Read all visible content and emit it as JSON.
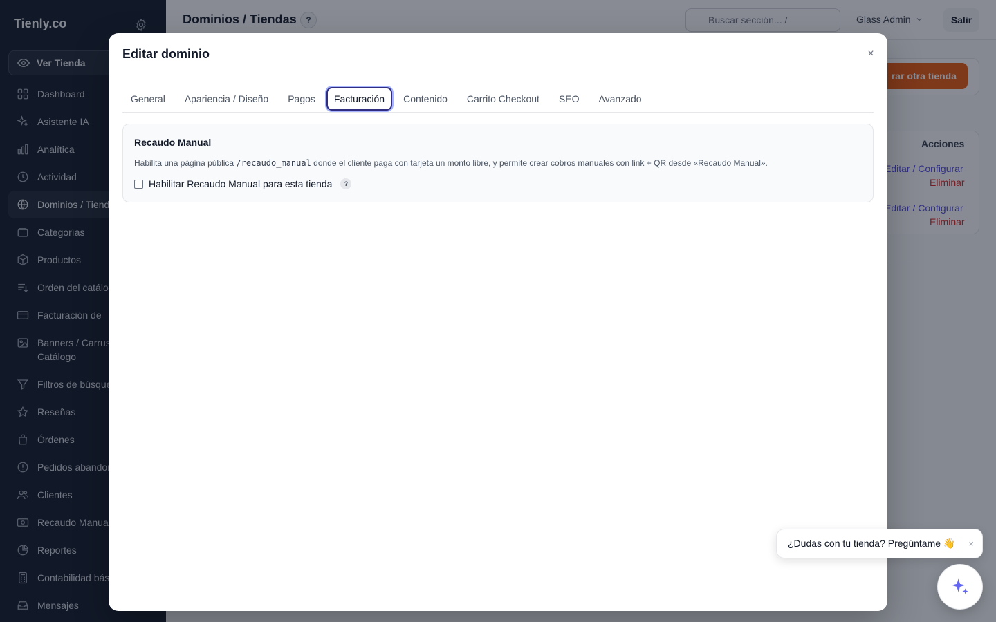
{
  "brand": "Tienly.co",
  "sidebar": {
    "ver_tienda": "Ver Tienda",
    "items": [
      {
        "label": "Dashboard",
        "icon": "grid-icon"
      },
      {
        "label": "Asistente IA",
        "icon": "sparkles-icon"
      },
      {
        "label": "Analítica",
        "icon": "bar-chart-icon"
      },
      {
        "label": "Actividad",
        "icon": "clock-icon"
      },
      {
        "label": "Dominios / Tiendas",
        "icon": "globe-icon"
      },
      {
        "label": "Categorías",
        "icon": "folder-icon"
      },
      {
        "label": "Productos",
        "icon": "cube-icon"
      },
      {
        "label": "Orden del catálogo",
        "icon": "sort-icon"
      },
      {
        "label": "Facturación de",
        "icon": "credit-card-icon"
      },
      {
        "label": "Banners / Carrusel Catálogo",
        "icon": "image-icon"
      },
      {
        "label": "Filtros de búsqueda",
        "icon": "filter-icon"
      },
      {
        "label": "Reseñas",
        "icon": "star-icon"
      },
      {
        "label": "Órdenes",
        "icon": "shopping-bag-icon"
      },
      {
        "label": "Pedidos abandonados",
        "icon": "alert-circle-icon"
      },
      {
        "label": "Clientes",
        "icon": "users-icon"
      },
      {
        "label": "Recaudo Manual",
        "icon": "cash-icon"
      },
      {
        "label": "Reportes",
        "icon": "pie-chart-icon"
      },
      {
        "label": "Contabilidad básica",
        "icon": "calculator-icon"
      },
      {
        "label": "Mensajes",
        "icon": "inbox-icon"
      }
    ]
  },
  "header": {
    "title": "Dominios / Tiendas",
    "help": "?",
    "search_placeholder": "Buscar sección...  /",
    "user": "Glass Admin",
    "logout": "Salir"
  },
  "background": {
    "create_button": "rar otra tienda",
    "actions_header": "Acciones",
    "rows": [
      {
        "edit": "Editar / Configurar",
        "delete": "Eliminar"
      },
      {
        "edit": "Editar / Configurar",
        "delete": "Eliminar"
      }
    ]
  },
  "modal": {
    "title": "Editar dominio",
    "close": "×",
    "tabs": [
      "General",
      "Apariencia / Diseño",
      "Pagos",
      "Facturación",
      "Contenido",
      "Carrito Checkout",
      "SEO",
      "Avanzado"
    ],
    "active_tab": "Facturación",
    "section": {
      "title": "Recaudo Manual",
      "desc_before": "Habilita una página pública ",
      "desc_code": "/recaudo_manual",
      "desc_after": " donde el cliente paga con tarjeta un monto libre, y permite crear cobros manuales con link + QR desde «Recaudo Manual».",
      "checkbox_label": "Habilitar Recaudo Manual para esta tienda",
      "checkbox_checked": false,
      "help": "?"
    }
  },
  "chat": {
    "bubble": "¿Dudas con tu tienda? Pregúntame 👋",
    "close": "×"
  },
  "colors": {
    "sidebar_bg": "#111827",
    "accent": "#4f46e5",
    "orange": "#ea580c",
    "danger": "#dc2626",
    "sparkle": "#6366f1"
  }
}
